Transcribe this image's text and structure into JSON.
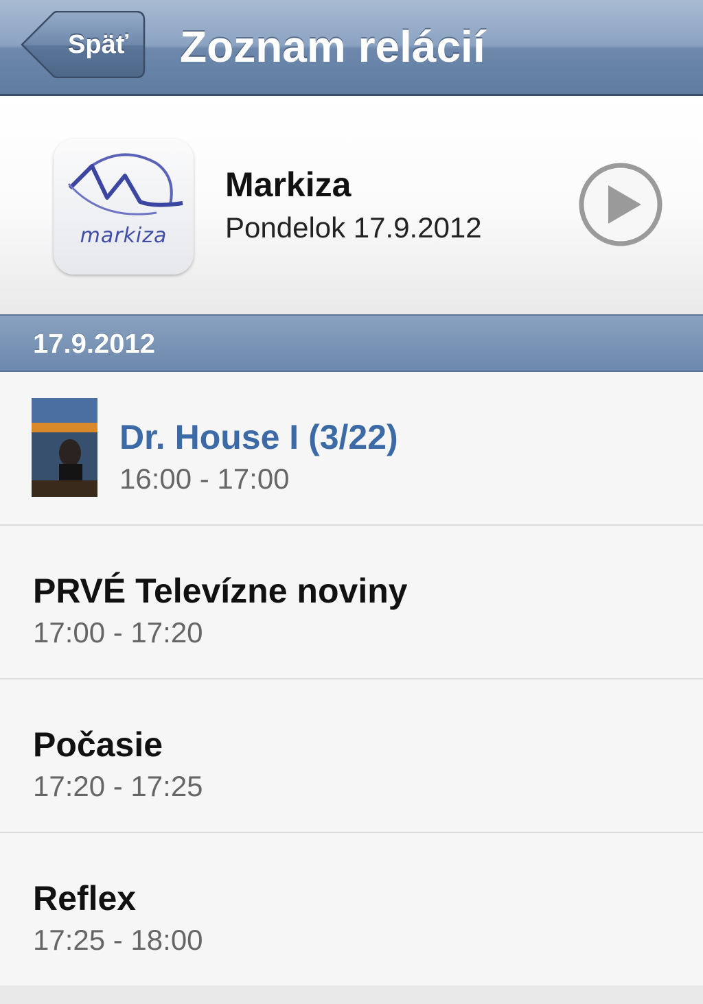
{
  "navbar": {
    "back_label": "Späť",
    "title": "Zoznam relácií"
  },
  "channel": {
    "name": "Markiza",
    "date": "Pondelok 17.9.2012",
    "logo_text": "markiza",
    "play_icon": "play-circle-icon"
  },
  "section": {
    "title": "17.9.2012"
  },
  "programs": [
    {
      "title": "Dr. House I (3/22)",
      "time": "16:00 - 17:00"
    },
    {
      "title": "PRVÉ Televízne noviny",
      "time": "17:00 - 17:20"
    },
    {
      "title": "Počasie",
      "time": "17:20 - 17:25"
    },
    {
      "title": "Reflex",
      "time": "17:25 - 18:00"
    }
  ],
  "colors": {
    "nav_blue": "#6d88ab",
    "active_title": "#3c6aa6",
    "logo_purple": "#3f4da8"
  }
}
